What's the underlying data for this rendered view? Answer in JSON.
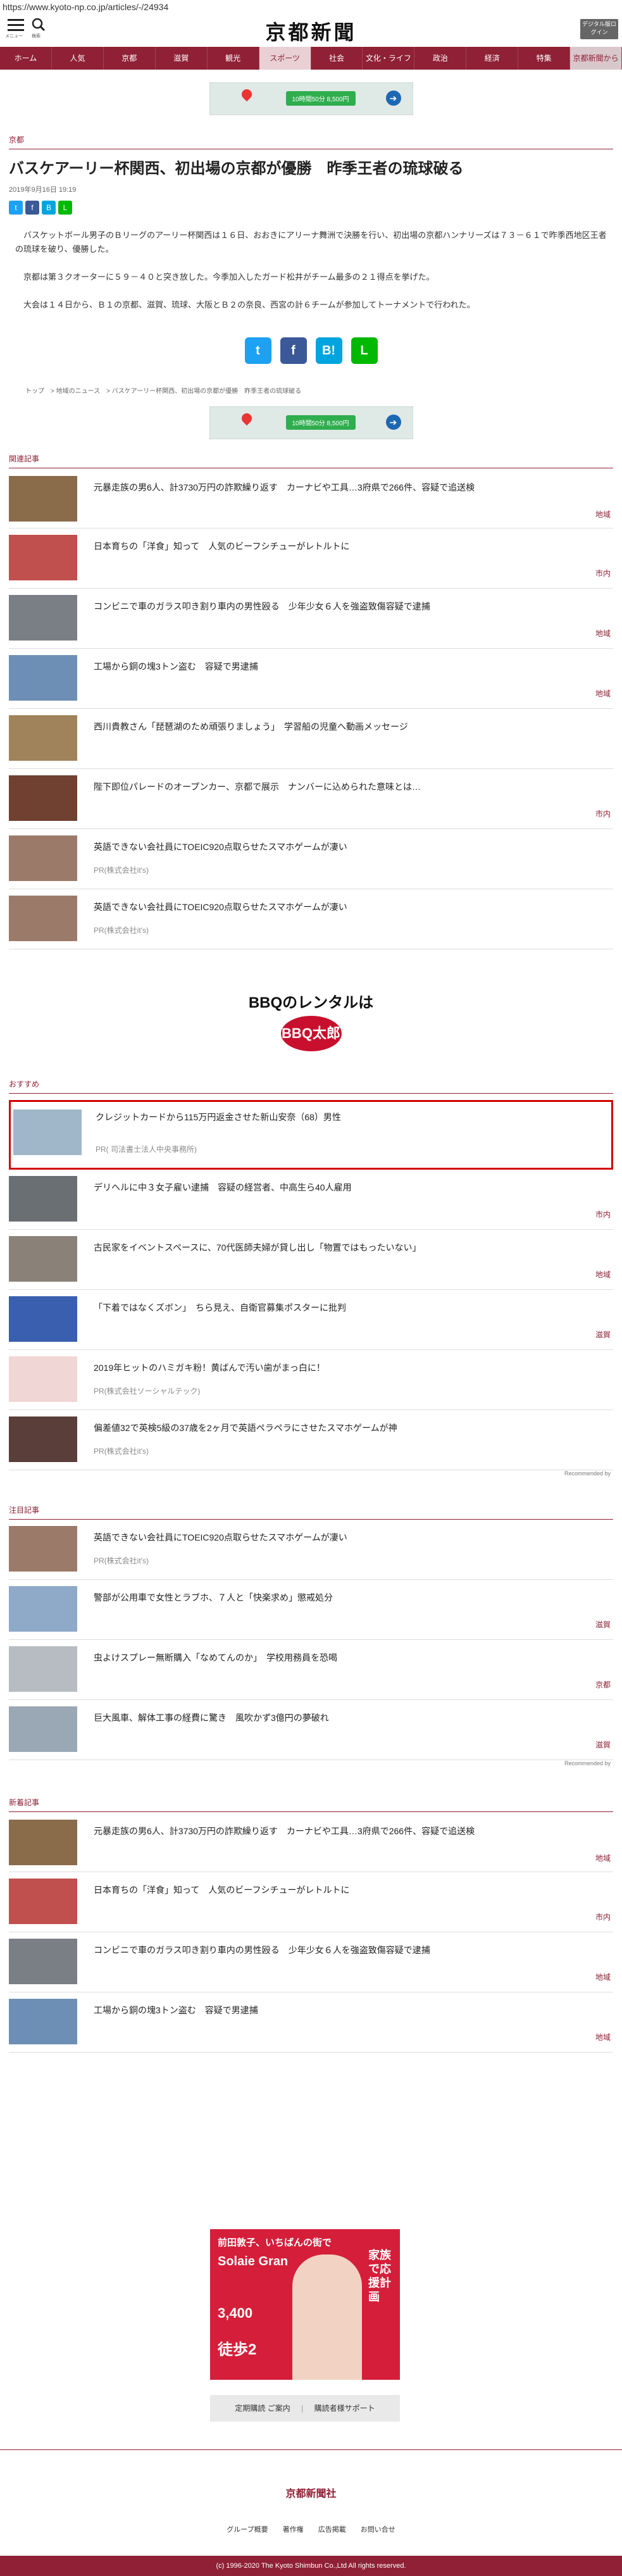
{
  "url": "https://www.kyoto-np.co.jp/articles/-/24934",
  "header": {
    "menu_label": "メニュー",
    "search_label": "検索",
    "logo": "京都新聞",
    "digital_label": "デジタル版ログイン"
  },
  "nav": [
    "ホーム",
    "人気",
    "京都",
    "滋賀",
    "観光",
    "スポーツ",
    "社会",
    "文化・ライフ",
    "政治",
    "経済",
    "特集",
    "京都新聞から"
  ],
  "ad_banner_label": "10時間50分 8,500円",
  "article": {
    "section": "京都",
    "title": "バスケアーリー杯関西、初出場の京都が優勝　昨季王者の琉球破る",
    "date": "2019年9月16日 19:19",
    "paragraphs": [
      "　バスケットボール男子のＢリーグのアーリー杯関西は１６日、おおきにアリーナ舞洲で決勝を行い、初出場の京都ハンナリーズは７３－６１で昨季西地区王者の琉球を破り、優勝した。",
      "　京都は第３クオーターに５９－４０と突き放した。今季加入したガード松井がチーム最多の２１得点を挙げた。",
      "　大会は１４日から、Ｂ１の京都、滋賀、琉球、大阪とＢ２の奈良、西宮の計６チームが参加してトーナメントで行われた。"
    ]
  },
  "breadcrumb": [
    "トップ",
    "地域のニュース",
    "バスケアーリー杯関西、初出場の京都が優勝　昨季王者の琉球破る"
  ],
  "related": {
    "heading": "関連記事",
    "items": [
      {
        "title": "元暴走族の男6人、計3730万円の詐欺繰り返す　カーナビや工具…3府県で266件、容疑で追送検",
        "cat": "地域"
      },
      {
        "title": "日本育ちの「洋食」知って　人気のビーフシチューがレトルトに",
        "cat": "市内"
      },
      {
        "title": "コンビニで車のガラス叩き割り車内の男性殴る　少年少女６人を強盗致傷容疑で逮捕",
        "cat": "地域"
      },
      {
        "title": "工場から銅の塊3トン盗む　容疑で男逮捕",
        "cat": "地域"
      },
      {
        "title": "西川貴教さん「琵琶湖のため頑張りましょう」　学習船の児童へ動画メッセージ",
        "cat": ""
      },
      {
        "title": "陛下即位パレードのオープンカー、京都で展示　ナンバーに込められた意味とは…",
        "cat": "市内"
      },
      {
        "title": "英語できない会社員にTOEIC920点取らせたスマホゲームが凄い",
        "pr": "PR(株式会社it's)"
      },
      {
        "title": "英語できない会社員にTOEIC920点取らせたスマホゲームが凄い",
        "pr": "PR(株式会社it's)"
      }
    ]
  },
  "bbq_ad": {
    "line1": "BBQのレンタルは",
    "brand": "BBQ太郎"
  },
  "recommend": {
    "heading": "おすすめ",
    "items": [
      {
        "title": "クレジットカードから115万円返金させた新山安奈（68）男性",
        "pr": "PR( 司法書士法人中央事務所)"
      },
      {
        "title": "デリヘルに中３女子雇い逮捕　容疑の経営者、中高生ら40人雇用",
        "cat": "市内"
      },
      {
        "title": "古民家をイベントスペースに、70代医師夫婦が貸し出し「物置ではもったいない」",
        "cat": "地域"
      },
      {
        "title": "「下着ではなくズボン」　ちら見え、自衛官募集ポスターに批判",
        "cat": "滋賀"
      },
      {
        "title": "2019年ヒットのハミガキ粉！黄ばんで汚い歯がまっ白に！",
        "pr": "PR(株式会社ソーシャルテック)"
      },
      {
        "title": "偏差値32で英検5級の37歳を2ヶ月で英語ペラペラにさせたスマホゲームが神",
        "pr": "PR(株式会社it's)"
      }
    ],
    "credit": "Recommended by"
  },
  "attention": {
    "heading": "注目記事",
    "items": [
      {
        "title": "英語できない会社員にTOEIC920点取らせたスマホゲームが凄い",
        "pr": "PR(株式会社it's)"
      },
      {
        "title": "警部が公用車で女性とラブホ、７人と「快楽求め」懲戒処分",
        "cat": "滋賀"
      },
      {
        "title": "虫よけスプレー無断購入「なめてんのか」　学校用務員を恐喝",
        "cat": "京都"
      },
      {
        "title": "巨大風車、解体工事の経費に驚き　風吹かず3億円の夢破れ",
        "cat": "滋賀"
      }
    ],
    "credit": "Recommended by"
  },
  "newest": {
    "heading": "新着記事",
    "items": [
      {
        "title": "元暴走族の男6人、計3730万円の詐欺繰り返す　カーナビや工具…3府県で266件、容疑で追送検",
        "cat": "地域"
      },
      {
        "title": "日本育ちの「洋食」知って　人気のビーフシチューがレトルトに",
        "cat": "市内"
      },
      {
        "title": "コンビニで車のガラス叩き割り車内の男性殴る　少年少女６人を強盗致傷容疑で逮捕",
        "cat": "地域"
      },
      {
        "title": "工場から銅の塊3トン盗む　容疑で男逮捕",
        "cat": "地域"
      }
    ]
  },
  "bottom_ad": {
    "brand_line": "前田敦子、いちばんの街で",
    "name": "Solaie Gran",
    "price": "3,400",
    "walk": "徒歩2",
    "side": "家族で応援計画"
  },
  "bottom_buttons": {
    "left": "定期購読 ご案内",
    "right": "購読者様サポート"
  },
  "footer": {
    "logo": "京都新聞社",
    "links": [
      "グループ概要",
      "著作権",
      "広告掲載",
      "お問い合せ"
    ],
    "copyright": "(c) 1996-2020 The Kyoto Shimbun Co.,Ltd All rights reserved."
  }
}
